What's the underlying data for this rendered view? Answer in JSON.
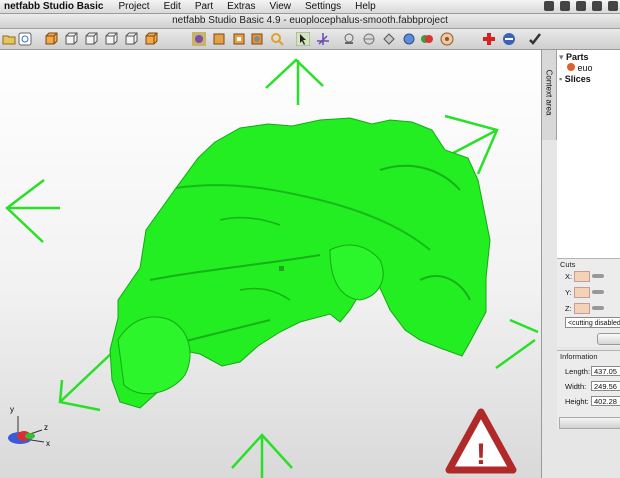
{
  "menubar": {
    "app_name": "netfabb Studio Basic",
    "items": [
      "Project",
      "Edit",
      "Part",
      "Extras",
      "View",
      "Settings",
      "Help"
    ]
  },
  "window": {
    "title": "netfabb Studio Basic 4.9 - euoplocephalus-smooth.fabbproject"
  },
  "toolbar": {
    "icons": [
      "open-icon",
      "info-icon",
      "view-front-icon",
      "view-back-icon",
      "view-left-icon",
      "view-right-icon",
      "view-top-icon",
      "view-bottom-icon",
      "shading-icon",
      "solid-view-icon",
      "wireframe-view-icon",
      "zoom-icon",
      "select-icon",
      "move-icon",
      "measure-icon",
      "cut-icon",
      "shape-icon",
      "analysis-icon",
      "color-icon",
      "repair-icon",
      "add-part-icon",
      "settings-icon",
      "remove-icon",
      "confirm-icon"
    ]
  },
  "sidebar": {
    "context_tab": "Context area",
    "tree": {
      "parts_label": "Parts",
      "part_name": "euo",
      "slices_label": "Slices"
    },
    "cuts": {
      "header": "Cuts",
      "axes": [
        "X:",
        "Y:",
        "Z:"
      ],
      "dropdown_value": "<cutting disabled"
    },
    "information": {
      "header": "Information",
      "length_label": "Length:",
      "length_value": "437.05",
      "width_label": "Width:",
      "width_value": "249.56",
      "height_label": "Height:",
      "height_value": "402.28"
    }
  },
  "viewport": {
    "axis_labels": [
      "y",
      "z",
      "x"
    ],
    "warning_symbol": "!"
  },
  "colors": {
    "model": "#22ee22",
    "handles": "#28e028",
    "warning": "#c0392b"
  }
}
